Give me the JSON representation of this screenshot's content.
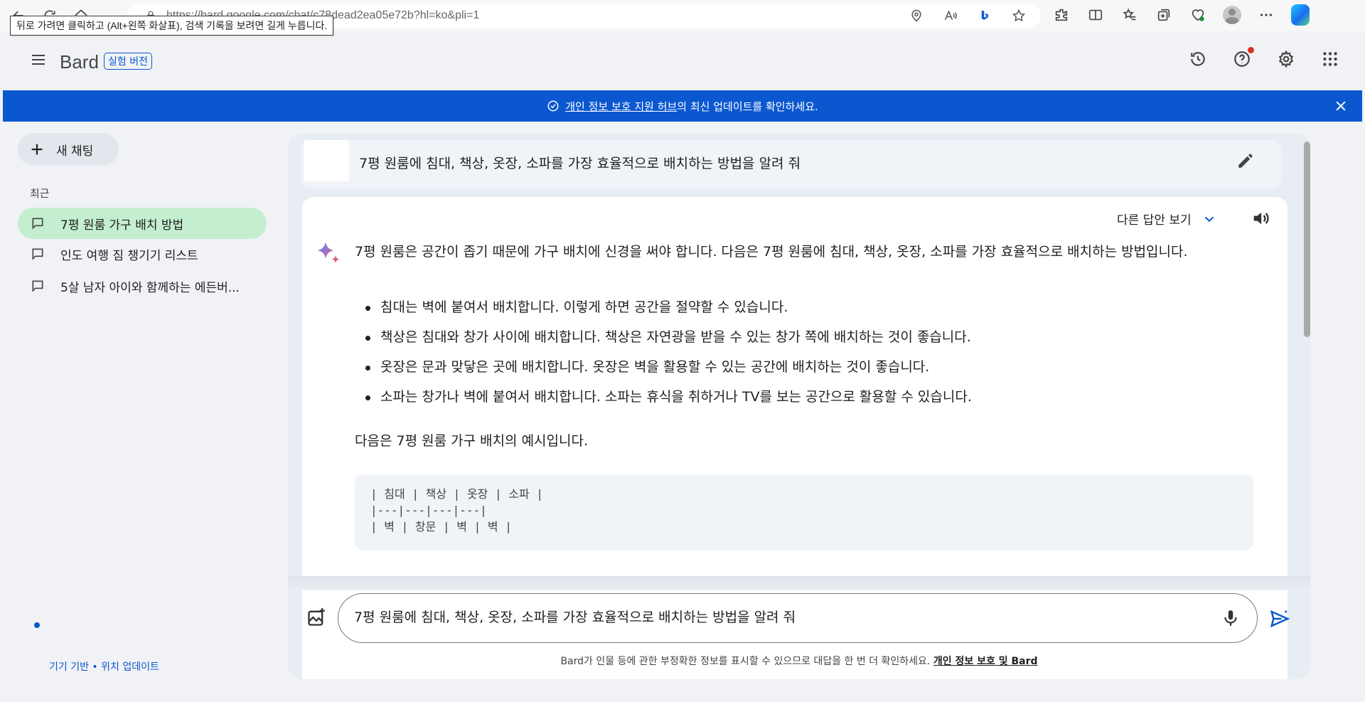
{
  "browser": {
    "url": "https://bard.google.com/chat/c78dead2ea05e72b?hl=ko&pli=1",
    "tooltip": "뒤로 가려면 클릭하고 (Alt+왼쪽 화살표), 검색 기록을 보려면 길게 누릅니다."
  },
  "header": {
    "brand": "Bard",
    "badge": "실험 버전",
    "icons": [
      "history-icon",
      "help-icon",
      "settings-icon",
      "apps-icon"
    ]
  },
  "banner": {
    "link_text": "개인 정보 보호 지원 허브 ",
    "rest_text": "의 최신 업데이트를 확인하세요."
  },
  "sidebar": {
    "new_chat_label": "새 채팅",
    "recent_label": "최근",
    "items": [
      {
        "label": "7평 원룸 가구 배치 방법",
        "active": true
      },
      {
        "label": "인도 여행 짐 챙기기 리스트",
        "active": false
      },
      {
        "label": "5살 남자 아이와 함께하는 에든버...",
        "active": false
      }
    ],
    "location_text": "기기 기반 • 위치 업데이트"
  },
  "chat": {
    "prompt": "7평 원룸에 침대, 책상, 옷장, 소파를 가장 효율적으로 배치하는 방법을 알려 줘",
    "drafts_label": "다른 답안 보기",
    "response": {
      "intro": "7평 원룸은 공간이 좁기 때문에 가구 배치에 신경을 써야 합니다. 다음은 7평 원룸에 침대, 책상, 옷장, 소파를 가장 효율적으로 배치하는 방법입니다.",
      "bullets": [
        "침대는 벽에 붙여서 배치합니다. 이렇게 하면 공간을 절약할 수 있습니다.",
        "책상은 침대와 창가 사이에 배치합니다. 책상은 자연광을 받을 수 있는 창가 쪽에 배치하는 것이 좋습니다.",
        "옷장은 문과 맞닿은 곳에 배치합니다. 옷장은 벽을 활용할 수 있는 공간에 배치하는 것이 좋습니다.",
        "소파는 창가나 벽에 붙여서 배치합니다. 소파는 휴식을 취하거나 TV를 보는 공간으로 활용할 수 있습니다."
      ],
      "example_caption": "다음은 7평 원룸 가구 배치의 예시입니다.",
      "code_lines": [
        "| 침대 | 책상 | 옷장 | 소파 |",
        "|---|---|---|---|",
        "| 벽 | 창문 | 벽 | 벽 |"
      ]
    }
  },
  "composer": {
    "value": "7평 원룸에 침대, 책상, 옷장, 소파를 가장 효율적으로 배치하는 방법을 알려 줘",
    "disclaimer": "Bard가 인물 등에 관한 부정확한 정보를 표시할 수 있으므로 대답을 한 번 더 확인하세요. ",
    "disclaimer_link": "개인 정보 보호 및 Bard"
  },
  "colors": {
    "accent": "#0b57d0",
    "active_item": "#c4eed0",
    "notification": "#d93025"
  }
}
